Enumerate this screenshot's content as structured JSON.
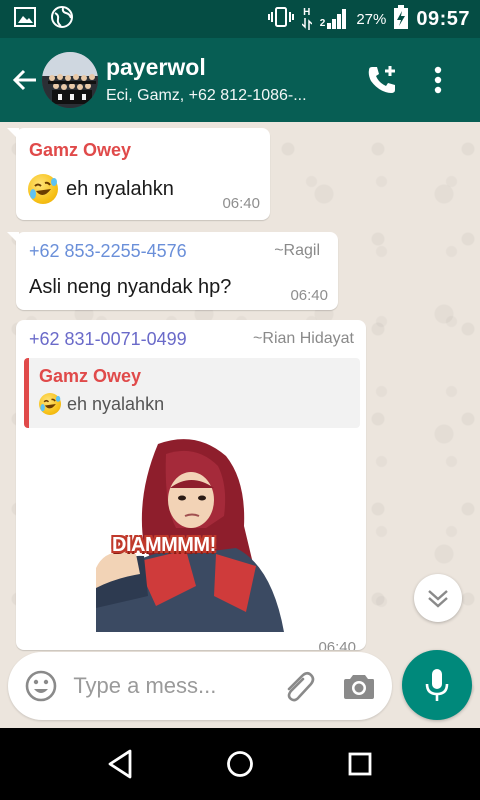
{
  "status_bar": {
    "network_type": "H",
    "sim_slot": "2",
    "battery": "27%",
    "time": "09:57"
  },
  "header": {
    "title": "payerwol",
    "subtitle": "Eci, Gamz, +62 812-1086-...",
    "icons": [
      "back-arrow-icon",
      "add-call-icon",
      "more-vert-icon"
    ]
  },
  "messages": [
    {
      "sender": "Gamz Owey",
      "sender_color": "#e04a4a",
      "emoji": "rolling-on-floor-laughing",
      "text": "eh nyalahkn",
      "time": "06:40"
    },
    {
      "sender": "+62 853-2255-4576",
      "sender_color": "#6a8fd9",
      "sender_name": "~Ragil",
      "text": "Asli neng nyandak hp?",
      "time": "06:40"
    },
    {
      "sender": "+62 831-0071-0499",
      "sender_color": "#6a6ac9",
      "sender_name": "~Rian Hidayat",
      "quote": {
        "sender": "Gamz Owey",
        "emoji": "rolling-on-floor-laughing",
        "text": "eh nyalahkn"
      },
      "sticker_text": "DIAMMMM!",
      "time": "06:40"
    }
  ],
  "input": {
    "placeholder": "Type a mess...",
    "value": ""
  },
  "colors": {
    "status_bar": "#054d44",
    "header": "#075e54",
    "chat_bg": "#ece5dd",
    "accent": "#00897b"
  }
}
